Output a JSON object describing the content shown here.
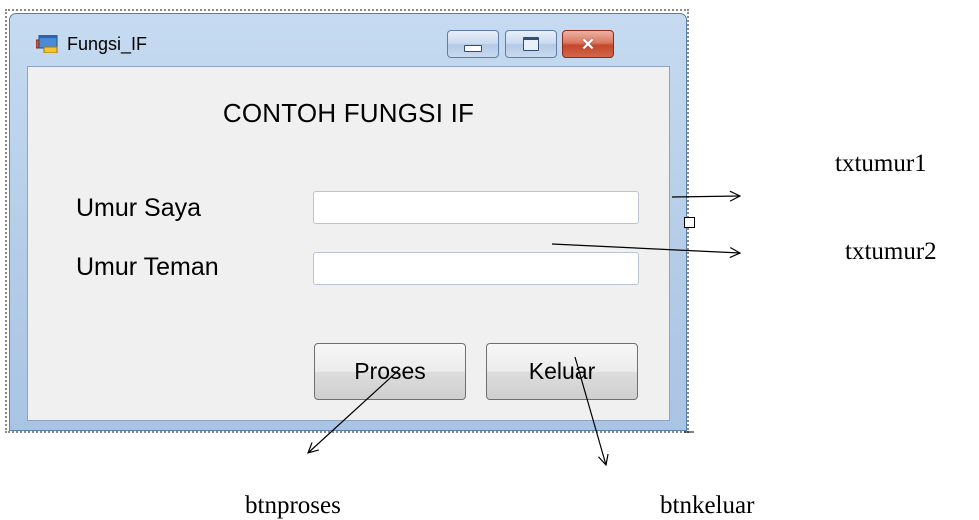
{
  "window": {
    "title": "Fungsi_IF",
    "close_glyph": "✕"
  },
  "form": {
    "heading": "CONTOH FUNGSI IF",
    "label_umur_saya": "Umur Saya",
    "label_umur_teman": "Umur Teman",
    "input_umur_saya_value": "",
    "input_umur_teman_value": "",
    "button_proses": "Proses",
    "button_keluar": "Keluar"
  },
  "annotations": {
    "txtumur1": "txtumur1",
    "txtumur2": "txtumur2",
    "btnproses": "btnproses",
    "btnkeluar": "btnkeluar"
  },
  "colors": {
    "client_bg": "#f0f0f0",
    "window_frame": "#b5cde8",
    "close_button": "#c4472b"
  }
}
